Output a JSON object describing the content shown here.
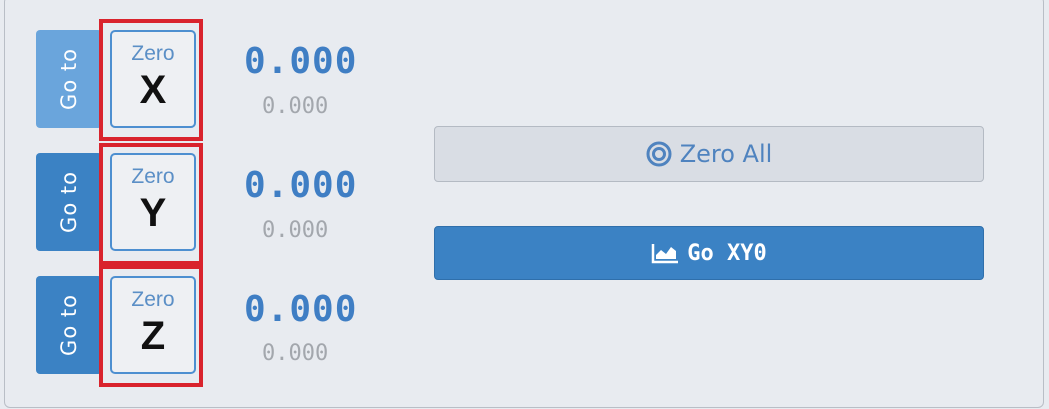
{
  "axes": [
    {
      "name": "X",
      "goto_label": "Go to",
      "zero_label": "Zero",
      "axis_letter": "X",
      "work_position": "0.000",
      "machine_position": "0.000"
    },
    {
      "name": "Y",
      "goto_label": "Go to",
      "zero_label": "Zero",
      "axis_letter": "Y",
      "work_position": "0.000",
      "machine_position": "0.000"
    },
    {
      "name": "Z",
      "goto_label": "Go to",
      "zero_label": "Zero",
      "axis_letter": "Z",
      "work_position": "0.000",
      "machine_position": "0.000"
    }
  ],
  "actions": {
    "zero_all_label": "Zero All",
    "zero_all_icon": "target-icon",
    "go_xy0_label": "Go XY0",
    "go_xy0_icon": "area-chart-icon"
  },
  "colors": {
    "primary_blue": "#3b82c4",
    "highlight_red": "#d9232d",
    "position_blue": "#3f7ec4"
  }
}
